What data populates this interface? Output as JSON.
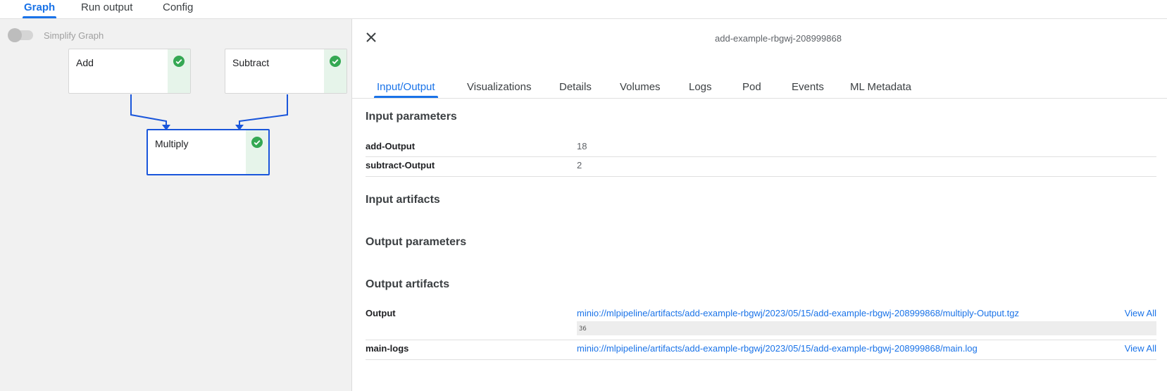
{
  "top_tabs": [
    "Graph",
    "Run output",
    "Config"
  ],
  "graph": {
    "simplify_label": "Simplify Graph",
    "nodes": [
      {
        "label": "Add",
        "status": "succeeded"
      },
      {
        "label": "Subtract",
        "status": "succeeded"
      },
      {
        "label": "Multiply",
        "status": "succeeded"
      }
    ],
    "status_color": "#34a853",
    "edge_color": "#1a56db"
  },
  "details": {
    "run_name": "add-example-rbgwj-208999868",
    "tabs": [
      "Input/Output",
      "Visualizations",
      "Details",
      "Volumes",
      "Logs",
      "Pod",
      "Events",
      "ML Metadata"
    ],
    "sections": {
      "input_parameters": "Input parameters",
      "input_artifacts": "Input artifacts",
      "output_parameters": "Output parameters",
      "output_artifacts": "Output artifacts"
    },
    "input_params": [
      {
        "key": "add-Output",
        "value": "18"
      },
      {
        "key": "subtract-Output",
        "value": "2"
      }
    ],
    "output_artifacts": [
      {
        "key": "Output",
        "uri": "minio://mlpipeline/artifacts/add-example-rbgwj/2023/05/15/add-example-rbgwj-208999868/multiply-Output.tgz",
        "preview": "36",
        "action": "View All"
      },
      {
        "key": "main-logs",
        "uri": "minio://mlpipeline/artifacts/add-example-rbgwj/2023/05/15/add-example-rbgwj-208999868/main.log",
        "action": "View All"
      }
    ]
  },
  "colors": {
    "accent": "#1a73e8",
    "success": "#34a853"
  }
}
